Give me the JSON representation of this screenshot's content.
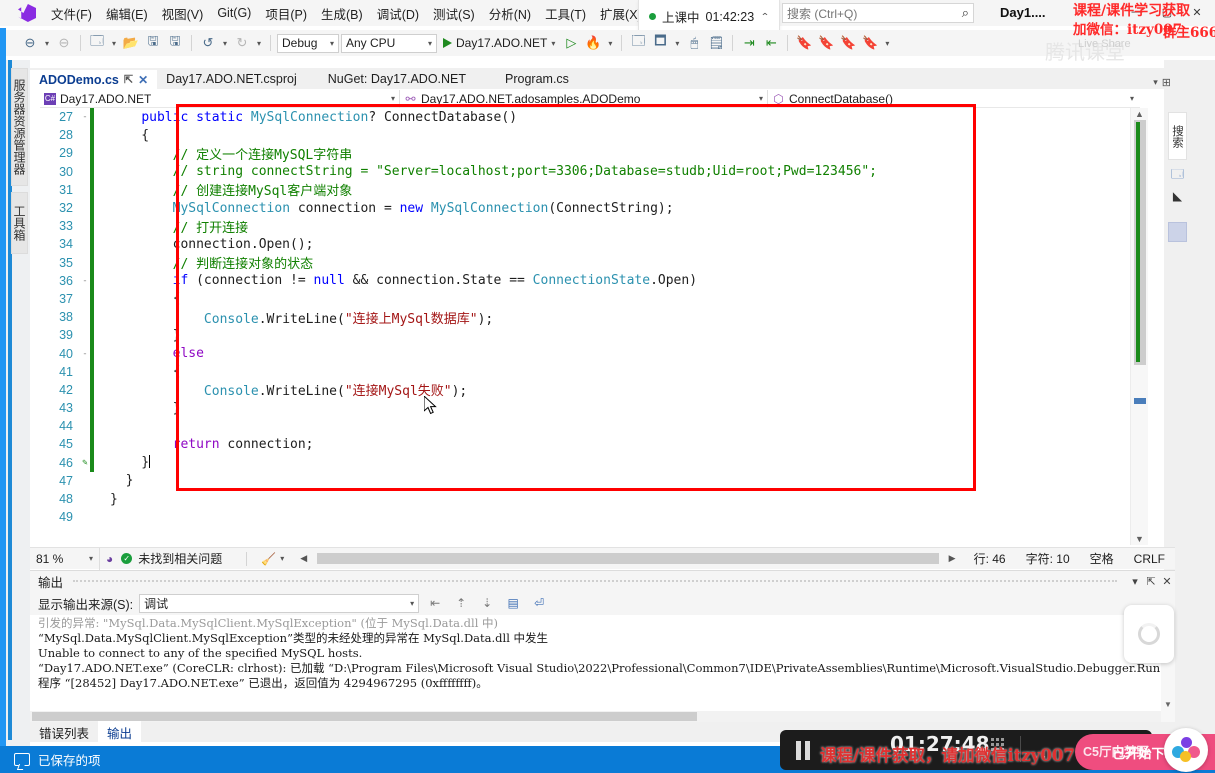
{
  "titlebar": {
    "logo_name": "visual-studio-logo",
    "menus": [
      "文件(F)",
      "编辑(E)",
      "视图(V)",
      "Git(G)",
      "项目(P)",
      "生成(B)",
      "调试(D)",
      "测试(S)",
      "分析(N)",
      "工具(T)",
      "扩展(X)"
    ],
    "session": {
      "status": "上课中",
      "time": "01:42:23",
      "chevron": "⌃"
    },
    "search_placeholder": "搜索 (Ctrl+Q)",
    "search_icon": "⌕",
    "window_title": "Day1....",
    "window_controls": [
      "—",
      "▢",
      "✕"
    ]
  },
  "toolbar": {
    "back_label": "◀",
    "forward_label": "▶",
    "new_project": "新建项目",
    "open_project": "打开项目",
    "save": "保存",
    "save_all": "全部保存",
    "undo": "撤销",
    "redo": "恢复",
    "configuration": "Debug",
    "platform": "Any CPU",
    "start_target": "Day17.ADO.NET",
    "start_without_debug": "开始执行(不调试)"
  },
  "tabs": {
    "items": [
      {
        "label": "ADODemo.cs",
        "active": true,
        "pinned": true,
        "closable": true
      },
      {
        "label": "Day17.ADO.NET.csproj",
        "active": false
      },
      {
        "label": "NuGet: Day17.ADO.NET",
        "active": false
      },
      {
        "label": "Program.cs",
        "active": false
      }
    ]
  },
  "navbar": {
    "project": "Day17.ADO.NET",
    "type": "Day17.ADO.NET.adosamples.ADODemo",
    "member": "ConnectDatabase()"
  },
  "editor": {
    "first_line": 27,
    "lines": [
      {
        "n": 27,
        "glyph": "-",
        "change": "green",
        "tokens": [
          {
            "t": "    ",
            "c": "p"
          },
          {
            "t": "public",
            "c": "k"
          },
          {
            "t": " ",
            "c": "p"
          },
          {
            "t": "static",
            "c": "k"
          },
          {
            "t": " ",
            "c": "p"
          },
          {
            "t": "MySqlConnection",
            "c": "t"
          },
          {
            "t": "? ",
            "c": "p"
          },
          {
            "t": "ConnectDatabase",
            "c": "p"
          },
          {
            "t": "()",
            "c": "p"
          }
        ]
      },
      {
        "n": 28,
        "glyph": "",
        "change": "green",
        "tokens": [
          {
            "t": "    {",
            "c": "p"
          }
        ]
      },
      {
        "n": 29,
        "glyph": "",
        "change": "green",
        "tokens": [
          {
            "t": "        // 定义一个连接MySQL字符串",
            "c": "c"
          }
        ]
      },
      {
        "n": 30,
        "glyph": "",
        "change": "green",
        "tokens": [
          {
            "t": "        // string connectString = \"Server=localhost;port=3306;Database=studb;Uid=root;Pwd=123456\";",
            "c": "c"
          }
        ]
      },
      {
        "n": 31,
        "glyph": "",
        "change": "green",
        "tokens": [
          {
            "t": "        // 创建连接MySql客户端对象",
            "c": "c"
          }
        ]
      },
      {
        "n": 32,
        "glyph": "",
        "change": "green",
        "tokens": [
          {
            "t": "        ",
            "c": "p"
          },
          {
            "t": "MySqlConnection",
            "c": "t"
          },
          {
            "t": " connection = ",
            "c": "p"
          },
          {
            "t": "new",
            "c": "k"
          },
          {
            "t": " ",
            "c": "p"
          },
          {
            "t": "MySqlConnection",
            "c": "t"
          },
          {
            "t": "(ConnectString);",
            "c": "p"
          }
        ]
      },
      {
        "n": 33,
        "glyph": "",
        "change": "green",
        "tokens": [
          {
            "t": "        // 打开连接",
            "c": "c"
          }
        ]
      },
      {
        "n": 34,
        "glyph": "",
        "change": "green",
        "tokens": [
          {
            "t": "        connection.Open();",
            "c": "p"
          }
        ]
      },
      {
        "n": 35,
        "glyph": "",
        "change": "green",
        "tokens": [
          {
            "t": "        // 判断连接对象的状态",
            "c": "c"
          }
        ]
      },
      {
        "n": 36,
        "glyph": "-",
        "change": "green",
        "tokens": [
          {
            "t": "        ",
            "c": "p"
          },
          {
            "t": "if",
            "c": "k"
          },
          {
            "t": " (connection != ",
            "c": "p"
          },
          {
            "t": "null",
            "c": "k"
          },
          {
            "t": " && connection.State == ",
            "c": "p"
          },
          {
            "t": "ConnectionState",
            "c": "t"
          },
          {
            "t": ".Open)",
            "c": "p"
          }
        ]
      },
      {
        "n": 37,
        "glyph": "",
        "change": "green",
        "tokens": [
          {
            "t": "        {",
            "c": "p"
          }
        ]
      },
      {
        "n": 38,
        "glyph": "",
        "change": "green",
        "tokens": [
          {
            "t": "            ",
            "c": "p"
          },
          {
            "t": "Console",
            "c": "t"
          },
          {
            "t": ".WriteLine(",
            "c": "p"
          },
          {
            "t": "\"连接上MySql数据库\"",
            "c": "s"
          },
          {
            "t": ");",
            "c": "p"
          }
        ]
      },
      {
        "n": 39,
        "glyph": "",
        "change": "green",
        "tokens": [
          {
            "t": "        }",
            "c": "p"
          }
        ]
      },
      {
        "n": 40,
        "glyph": "-",
        "change": "green",
        "tokens": [
          {
            "t": "        ",
            "c": "p"
          },
          {
            "t": "else",
            "c": "kv"
          }
        ]
      },
      {
        "n": 41,
        "glyph": "",
        "change": "green",
        "tokens": [
          {
            "t": "        {",
            "c": "p"
          }
        ]
      },
      {
        "n": 42,
        "glyph": "",
        "change": "green",
        "tokens": [
          {
            "t": "            ",
            "c": "p"
          },
          {
            "t": "Console",
            "c": "t"
          },
          {
            "t": ".WriteLine(",
            "c": "p"
          },
          {
            "t": "\"连接MySql失败\"",
            "c": "s"
          },
          {
            "t": ");",
            "c": "p"
          }
        ]
      },
      {
        "n": 43,
        "glyph": "",
        "change": "green",
        "tokens": [
          {
            "t": "        }",
            "c": "p"
          }
        ]
      },
      {
        "n": 44,
        "glyph": "",
        "change": "green",
        "tokens": [
          {
            "t": "",
            "c": "p"
          }
        ]
      },
      {
        "n": 45,
        "glyph": "",
        "change": "green",
        "tokens": [
          {
            "t": "        ",
            "c": "p"
          },
          {
            "t": "return",
            "c": "kv"
          },
          {
            "t": " connection;",
            "c": "p"
          }
        ]
      },
      {
        "n": 46,
        "glyph": "✎",
        "change": "green",
        "caret": true,
        "tokens": [
          {
            "t": "    }",
            "c": "p"
          }
        ]
      },
      {
        "n": 47,
        "glyph": "",
        "change": "",
        "tokens": [
          {
            "t": "  }",
            "c": "p"
          }
        ]
      },
      {
        "n": 48,
        "glyph": "",
        "change": "",
        "tokens": [
          {
            "t": "}",
            "c": "p"
          }
        ]
      },
      {
        "n": 49,
        "glyph": "",
        "change": "",
        "tokens": [
          {
            "t": "",
            "c": "p"
          }
        ]
      }
    ],
    "highlight_box_color": "#ff0000"
  },
  "editor_status": {
    "zoom": "81 %",
    "issue_icon": "issue-ok-icon",
    "issues": "未找到相关问题",
    "line_label": "行: 46",
    "col_label": "字符: 10",
    "space_label": "空格",
    "eol_label": "CRLF"
  },
  "output": {
    "title": "输出",
    "source_label": "显示输出来源(S):",
    "source_value": "调试",
    "lines": [
      "引发的异常: \"MySql.Data.MySqlClient.MySqlException\" (位于 MySql.Data.dll 中)",
      "“MySql.Data.MySqlClient.MySqlException”类型的未经处理的异常在 MySql.Data.dll 中发生",
      "Unable to connect to any of the specified MySQL hosts.",
      "",
      "“Day17.ADO.NET.exe” (CoreCLR: clrhost): 已加载 “D:\\Program Files\\Microsoft Visual Studio\\2022\\Professional\\Common7\\IDE\\PrivateAssemblies\\Runtime\\Microsoft.VisualStudio.Debugger.Run",
      "程序 “[28452] Day17.ADO.NET.exe” 已退出，返回值为 4294967295 (0xffffffff)。"
    ],
    "buttons": [
      "查找消息",
      "清除所有",
      "切换自动换行"
    ]
  },
  "bottom_tabs": [
    {
      "label": "错误列表",
      "selected": false
    },
    {
      "label": "输出",
      "selected": true
    }
  ],
  "statusbar": {
    "icon": "saved-item-icon",
    "text": "已保存的项"
  },
  "left_dock": [
    {
      "label": "服务器资源管理器"
    },
    {
      "label": "工具箱"
    }
  ],
  "right_dock": {
    "search_label": "搜索",
    "icons": [
      "solution-explorer-icon",
      "properties-icon"
    ]
  },
  "watermarks": {
    "top_line1": "课程/课件学习获取",
    "top_line2": "加微信：itzy007",
    "top_suffix": "群主666",
    "live_share": "Live Share",
    "player_text": "课程/课件获取，请加微信itzy007",
    "player_time": "01:27:48",
    "pink_label": "已开始下载",
    "pink_label2": "C5厅内梦野"
  },
  "colors": {
    "accent_blue": "#0a7bd6",
    "highlight_red": "#ff0000",
    "comment_green": "#108000",
    "string_red": "#a31515",
    "type_teal": "#2b91af",
    "keyword_blue": "#0000ff"
  }
}
